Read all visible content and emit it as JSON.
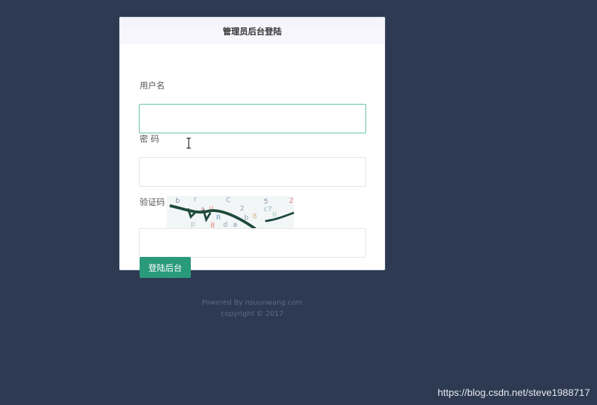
{
  "header": {
    "title": "管理员后台登陆"
  },
  "form": {
    "username_label": "用户名",
    "username_value": "",
    "password_label": "密 码",
    "password_value": "",
    "captcha_label": "验证码",
    "captcha_value": "",
    "submit_label": "登陆后台"
  },
  "footer": {
    "powered_by": "Powered By nsuunwang.com",
    "copyright": "copyright © 2017"
  },
  "watermark": "https://blog.csdn.net/steve1988717",
  "colors": {
    "background": "#2d3a52",
    "accent": "#2a9a7c",
    "focus_border": "#5fc39a"
  }
}
